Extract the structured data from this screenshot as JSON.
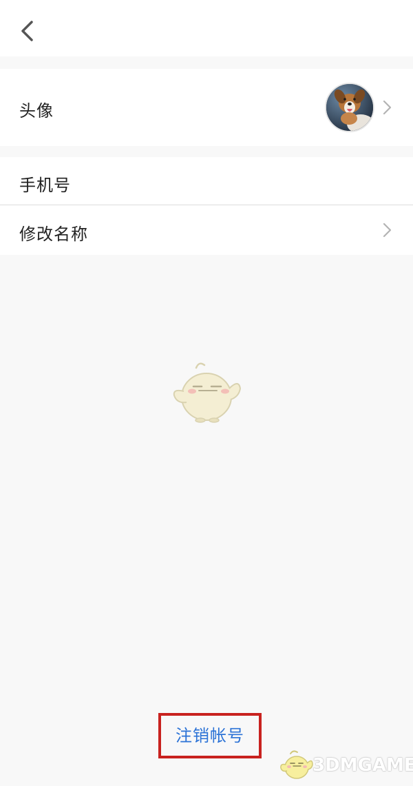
{
  "rows": {
    "avatar_label": "头像",
    "phone_label": "手机号",
    "rename_label": "修改名称"
  },
  "footer": {
    "logout_label": "注销帐号"
  },
  "watermark": {
    "text": "3DMGAME"
  },
  "colors": {
    "background": "#f8f8f8",
    "row_background": "#ffffff",
    "link_blue": "#2b72d6",
    "highlight_red": "#c8221f"
  },
  "icons": {
    "back": "chevron-left-icon",
    "row_arrow": "chevron-right-icon",
    "mascot": "empty-state-mascot-icon"
  }
}
